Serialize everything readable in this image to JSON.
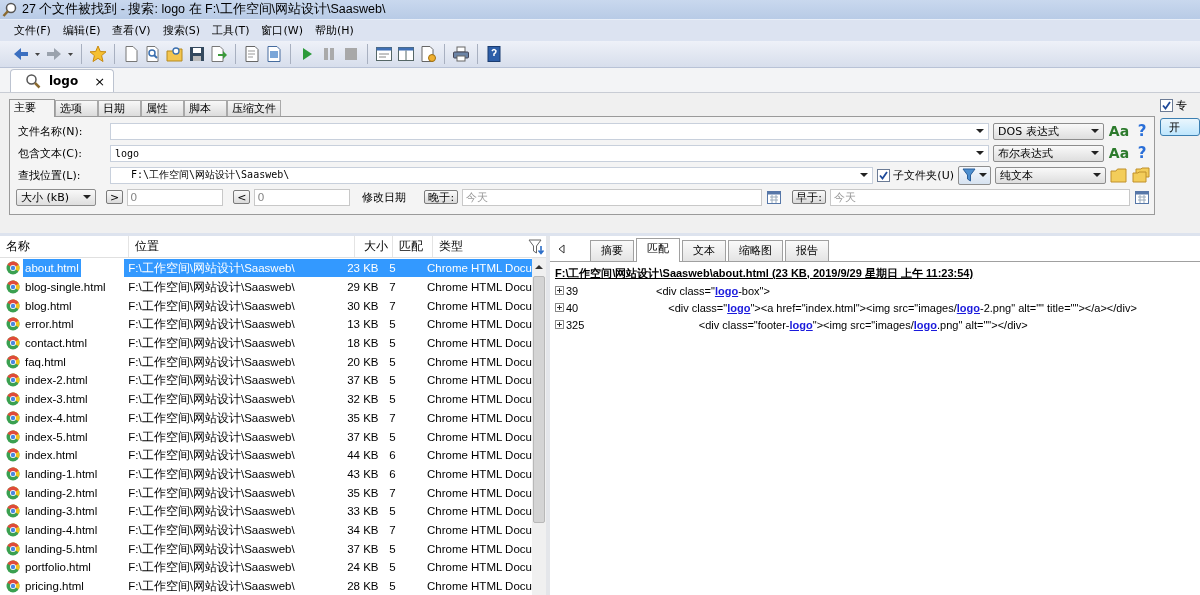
{
  "window": {
    "title": "27 个文件被找到 - 搜索: logo 在 F:\\工作空间\\网站设计\\Saasweb\\"
  },
  "menu": [
    "文件(F)",
    "编辑(E)",
    "查看(V)",
    "搜索(S)",
    "工具(T)",
    "窗口(W)",
    "帮助(H)"
  ],
  "document_tabs": [
    {
      "label": "logo",
      "close": "×",
      "selected": true
    }
  ],
  "search": {
    "tabs": [
      {
        "label": "主要",
        "selected": true
      },
      {
        "label": "选项",
        "selected": false
      },
      {
        "label": "日期",
        "selected": false
      },
      {
        "label": "属性",
        "selected": false
      },
      {
        "label": "脚本",
        "selected": false
      },
      {
        "label": "压缩文件",
        "selected": false
      }
    ],
    "file_name": {
      "label": "文件名称(N):",
      "mode": "DOS 表达式",
      "case": "Aa",
      "help": "?"
    },
    "containing_text": {
      "label": "包含文本(C):",
      "value": "logo",
      "mode": "布尔表达式",
      "case": "Aa",
      "help": "?"
    },
    "look_in": {
      "label": "查找位置(L):",
      "value": "F:\\工作空间\\网站设计\\Saasweb\\",
      "subfolders": {
        "label": "子文件夹(U)",
        "checked": true
      },
      "mode": "纯文本"
    },
    "size_filter": "大小 (kB)",
    "greater": ">",
    "min": "0",
    "less": "<",
    "max": "0",
    "date_label": "修改日期",
    "after": {
      "button": "晚于:",
      "placeholder": "今天"
    },
    "before": {
      "button": "早于:",
      "placeholder": "今天"
    },
    "expert": {
      "label": "专",
      "checked": true
    },
    "start_button": "开"
  },
  "results": {
    "columns": [
      "名称",
      "位置",
      "大小",
      "匹配",
      "类型"
    ],
    "rows": [
      {
        "name": "about.html",
        "location": "F:\\工作空间\\网站设计\\Saasweb\\",
        "size": "23 KB",
        "matches": "5",
        "type": "Chrome HTML Docu",
        "selected": true
      },
      {
        "name": "blog-single.html",
        "location": "F:\\工作空间\\网站设计\\Saasweb\\",
        "size": "29 KB",
        "matches": "7",
        "type": "Chrome HTML Docu",
        "selected": false
      },
      {
        "name": "blog.html",
        "location": "F:\\工作空间\\网站设计\\Saasweb\\",
        "size": "30 KB",
        "matches": "7",
        "type": "Chrome HTML Docu",
        "selected": false
      },
      {
        "name": "error.html",
        "location": "F:\\工作空间\\网站设计\\Saasweb\\",
        "size": "13 KB",
        "matches": "5",
        "type": "Chrome HTML Docu",
        "selected": false
      },
      {
        "name": "contact.html",
        "location": "F:\\工作空间\\网站设计\\Saasweb\\",
        "size": "18 KB",
        "matches": "5",
        "type": "Chrome HTML Docu",
        "selected": false
      },
      {
        "name": "faq.html",
        "location": "F:\\工作空间\\网站设计\\Saasweb\\",
        "size": "20 KB",
        "matches": "5",
        "type": "Chrome HTML Docu",
        "selected": false
      },
      {
        "name": "index-2.html",
        "location": "F:\\工作空间\\网站设计\\Saasweb\\",
        "size": "37 KB",
        "matches": "5",
        "type": "Chrome HTML Docu",
        "selected": false
      },
      {
        "name": "index-3.html",
        "location": "F:\\工作空间\\网站设计\\Saasweb\\",
        "size": "32 KB",
        "matches": "5",
        "type": "Chrome HTML Docu",
        "selected": false
      },
      {
        "name": "index-4.html",
        "location": "F:\\工作空间\\网站设计\\Saasweb\\",
        "size": "35 KB",
        "matches": "7",
        "type": "Chrome HTML Docu",
        "selected": false
      },
      {
        "name": "index-5.html",
        "location": "F:\\工作空间\\网站设计\\Saasweb\\",
        "size": "37 KB",
        "matches": "5",
        "type": "Chrome HTML Docu",
        "selected": false
      },
      {
        "name": "index.html",
        "location": "F:\\工作空间\\网站设计\\Saasweb\\",
        "size": "44 KB",
        "matches": "6",
        "type": "Chrome HTML Docu",
        "selected": false
      },
      {
        "name": "landing-1.html",
        "location": "F:\\工作空间\\网站设计\\Saasweb\\",
        "size": "43 KB",
        "matches": "6",
        "type": "Chrome HTML Docu",
        "selected": false
      },
      {
        "name": "landing-2.html",
        "location": "F:\\工作空间\\网站设计\\Saasweb\\",
        "size": "35 KB",
        "matches": "7",
        "type": "Chrome HTML Docu",
        "selected": false
      },
      {
        "name": "landing-3.html",
        "location": "F:\\工作空间\\网站设计\\Saasweb\\",
        "size": "33 KB",
        "matches": "5",
        "type": "Chrome HTML Docu",
        "selected": false
      },
      {
        "name": "landing-4.html",
        "location": "F:\\工作空间\\网站设计\\Saasweb\\",
        "size": "34 KB",
        "matches": "7",
        "type": "Chrome HTML Docu",
        "selected": false
      },
      {
        "name": "landing-5.html",
        "location": "F:\\工作空间\\网站设计\\Saasweb\\",
        "size": "37 KB",
        "matches": "5",
        "type": "Chrome HTML Docu",
        "selected": false
      },
      {
        "name": "portfolio.html",
        "location": "F:\\工作空间\\网站设计\\Saasweb\\",
        "size": "24 KB",
        "matches": "5",
        "type": "Chrome HTML Docu",
        "selected": false
      },
      {
        "name": "pricing.html",
        "location": "F:\\工作空间\\网站设计\\Saasweb\\",
        "size": "28 KB",
        "matches": "5",
        "type": "Chrome HTML Docu",
        "selected": false
      }
    ]
  },
  "preview": {
    "tabs": [
      {
        "label": "摘要",
        "selected": false
      },
      {
        "label": "匹配",
        "selected": true
      },
      {
        "label": "文本",
        "selected": false
      },
      {
        "label": "缩略图",
        "selected": false
      },
      {
        "label": "报告",
        "selected": false
      }
    ],
    "header": "F:\\工作空间\\网站设计\\Saasweb\\about.html  (23 KB, 2019/9/29 星期日 上午 11:23:54)",
    "lines": [
      {
        "number": "39",
        "expanded": false,
        "segments": [
          {
            "text": "<div class=\"",
            "hit": false
          },
          {
            "text": "logo",
            "hit": true
          },
          {
            "text": "-box\">",
            "hit": false
          }
        ]
      },
      {
        "number": "40",
        "expanded": false,
        "segments": [
          {
            "text": "    <div class=\"",
            "hit": false
          },
          {
            "text": "logo",
            "hit": true
          },
          {
            "text": "\"><a href=\"index.html\"><img src=\"images/",
            "hit": false
          },
          {
            "text": "logo",
            "hit": true
          },
          {
            "text": "-2.png\" alt=\"\" title=\"\"></a></div>",
            "hit": false
          }
        ]
      },
      {
        "number": "325",
        "expanded": false,
        "segments": [
          {
            "text": "              <div class=\"footer-",
            "hit": false
          },
          {
            "text": "logo",
            "hit": true
          },
          {
            "text": "\"><img src=\"images/",
            "hit": false
          },
          {
            "text": "logo",
            "hit": true
          },
          {
            "text": ".png\" alt=\"\"></div>",
            "hit": false
          }
        ]
      }
    ]
  }
}
